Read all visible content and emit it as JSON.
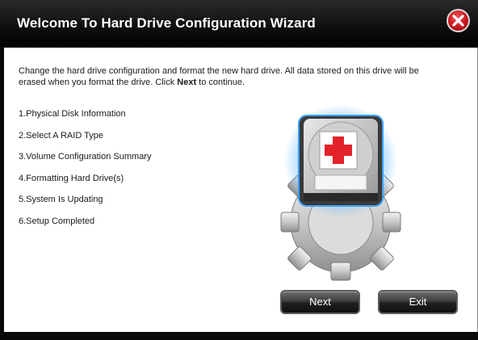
{
  "window": {
    "title": "Welcome To Hard Drive Configuration Wizard",
    "close_icon": "close-icon"
  },
  "intro": {
    "text_before": "Change the hard drive configuration and format the new hard drive. All data stored on this drive will be erased when you format the drive. Click ",
    "emphasis": "Next",
    "text_after": " to continue."
  },
  "steps": [
    "1.Physical Disk Information",
    "2.Select A RAID Type",
    "3.Volume Configuration Summary",
    "4.Formatting Hard Drive(s)",
    "5.System Is Updating",
    "6.Setup Completed"
  ],
  "buttons": {
    "next": "Next",
    "exit": "Exit"
  },
  "illustration": {
    "icon": "hard-drive-gear-icon",
    "accent_red": "#e3222a"
  }
}
